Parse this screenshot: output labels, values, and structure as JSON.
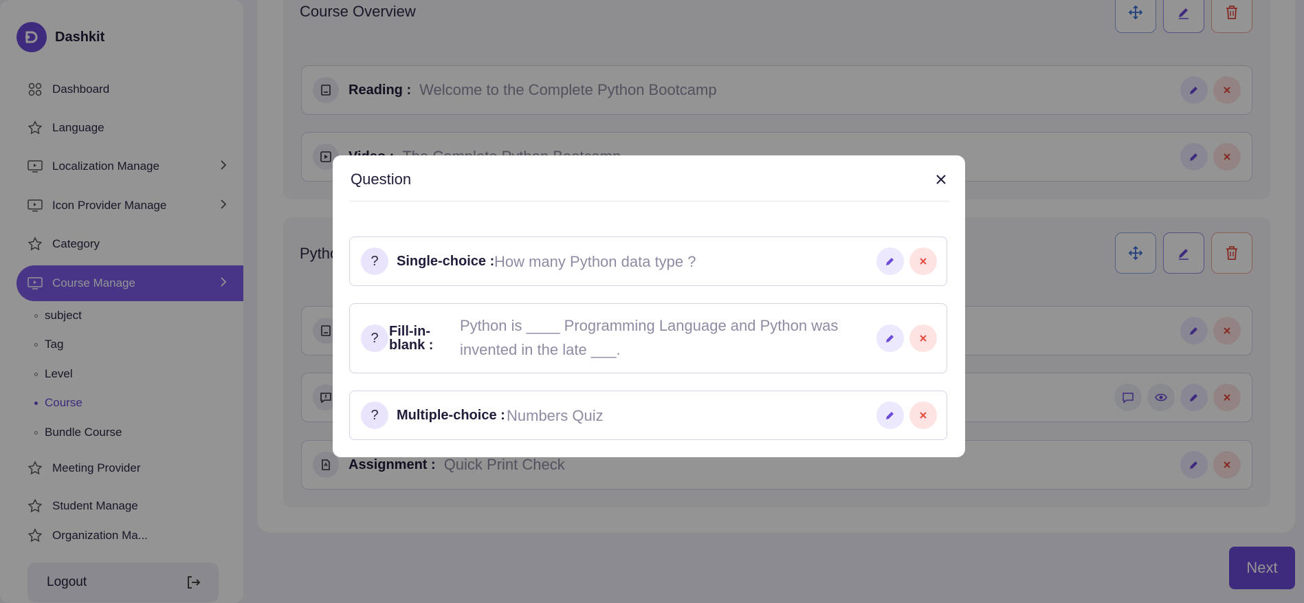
{
  "brand": {
    "name": "Dashkit",
    "logo_icon": "dashkit-logo-icon"
  },
  "sidebar": {
    "items": [
      {
        "label": "Dashboard",
        "icon": "grid-icon"
      },
      {
        "label": "Language",
        "icon": "star-icon"
      },
      {
        "label": "Localization Manage",
        "icon": "monitor-icon"
      },
      {
        "label": "Icon Provider Manage",
        "icon": "monitor-icon"
      },
      {
        "label": "Category",
        "icon": "star-icon"
      },
      {
        "label": "Course Manage",
        "icon": "monitor-icon",
        "active": true
      },
      {
        "label": "Meeting Provider",
        "icon": "star-icon"
      },
      {
        "label": "Student Manage",
        "icon": "star-icon"
      },
      {
        "label": "Organization Ma...",
        "icon": "star-icon"
      }
    ],
    "subitems": [
      "subject",
      "Tag",
      "Level",
      "Course",
      "Bundle Course"
    ],
    "active_subitem": "Course",
    "logout_label": "Logout"
  },
  "main": {
    "sections": [
      {
        "title": "Course Overview",
        "rows": [
          {
            "label": "Reading :",
            "value": "Welcome to the Complete Python Bootcamp"
          },
          {
            "label": "Video :",
            "value": "The Complete Python Bootcamp"
          }
        ]
      },
      {
        "title": "Pytho",
        "rows": [
          {
            "label": "",
            "value": ""
          },
          {
            "label": "",
            "value": ""
          },
          {
            "label": "Assignment :",
            "value": "Quick Print Check"
          }
        ]
      }
    ],
    "next_label": "Next"
  },
  "modal": {
    "title": "Question",
    "questions": [
      {
        "label": "Single-choice :",
        "value": "How many Python data type ?"
      },
      {
        "label": "Fill-in-blank :",
        "value": "Python is ____ Programming Language and Python was invented in the late ___."
      },
      {
        "label": "Multiple-choice :",
        "value": "Numbers Quiz"
      }
    ],
    "lead_symbol": "?"
  },
  "colors": {
    "accent": "#6d4ad8",
    "danger": "#e5483c",
    "info": "#3b6fd6"
  }
}
